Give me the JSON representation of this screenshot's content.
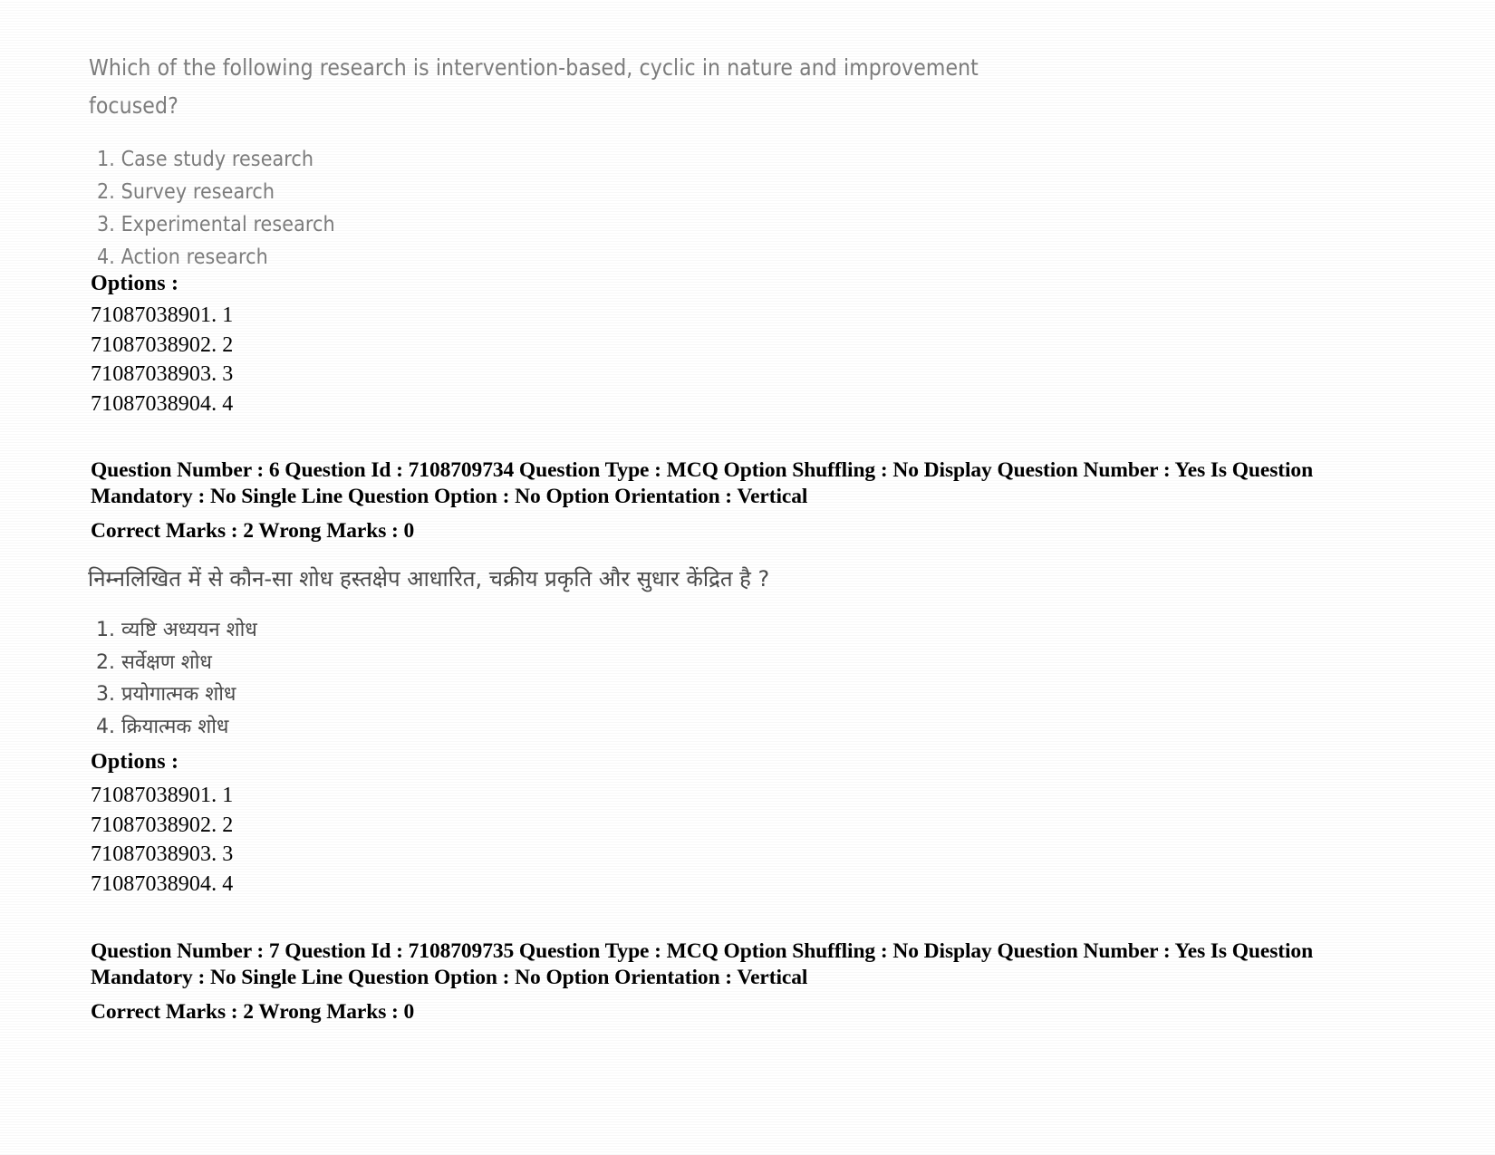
{
  "document": {
    "type": "exam-question-paper",
    "background_color": "#ffffff",
    "scan_text_color": "#7d7d7d",
    "meta_text_color": "#000000"
  },
  "question_en": {
    "stem": "Which of the following research is intervention-based, cyclic in nature and improvement focused?",
    "choices": [
      "1. Case study research",
      "2. Survey research",
      "3. Experimental research",
      "4. Action research"
    ],
    "options_label": "Options :",
    "option_ids": [
      "71087038901. 1",
      "71087038902. 2",
      "71087038903. 3",
      "71087038904. 4"
    ]
  },
  "meta_1": {
    "line1": "Question Number : 6 Question Id : 7108709734 Question Type : MCQ Option Shuffling : No Display Question Number : Yes Is Question",
    "line2": "Mandatory : No Single Line Question Option : No Option Orientation : Vertical",
    "marks": "Correct Marks : 2 Wrong Marks : 0",
    "fields": {
      "question_number": "6",
      "question_id": "7108709734",
      "question_type": "MCQ",
      "option_shuffling": "No",
      "display_question_number": "Yes",
      "is_question_mandatory": "No",
      "single_line_question_option": "No",
      "option_orientation": "Vertical",
      "correct_marks": "2",
      "wrong_marks": "0"
    }
  },
  "question_hi": {
    "stem": "निम्नलिखित में से कौन-सा शोध हस्तक्षेप आधारित, चक्रीय प्रकृति और सुधार केंद्रित है ?",
    "choices": [
      "1. व्यष्टि अध्ययन शोध",
      "2. सर्वेक्षण शोध",
      "3. प्रयोगात्मक शोध",
      "4. क्रियात्मक शोध"
    ],
    "options_label": "Options :",
    "option_ids": [
      "71087038901. 1",
      "71087038902. 2",
      "71087038903. 3",
      "71087038904. 4"
    ]
  },
  "meta_2": {
    "line1": "Question Number : 7 Question Id : 7108709735 Question Type : MCQ Option Shuffling : No Display Question Number : Yes Is Question",
    "line2": "Mandatory : No Single Line Question Option : No Option Orientation : Vertical",
    "marks": "Correct Marks : 2 Wrong Marks : 0",
    "fields": {
      "question_number": "7",
      "question_id": "7108709735",
      "question_type": "MCQ",
      "option_shuffling": "No",
      "display_question_number": "Yes",
      "is_question_mandatory": "No",
      "single_line_question_option": "No",
      "option_orientation": "Vertical",
      "correct_marks": "2",
      "wrong_marks": "0"
    }
  }
}
